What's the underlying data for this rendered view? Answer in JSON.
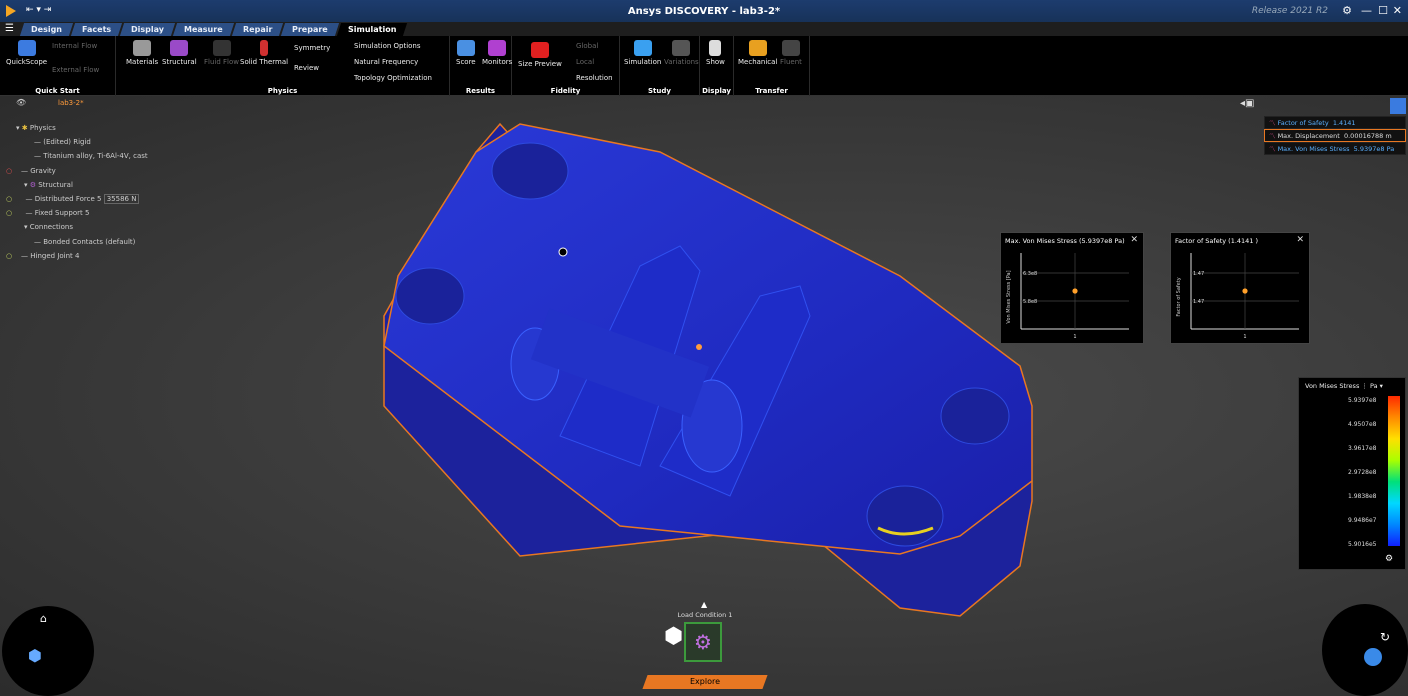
{
  "titlebar": {
    "title": "Ansys DISCOVERY - lab3-2*",
    "release": "Release 2021 R2"
  },
  "tabs": [
    {
      "label": "Design"
    },
    {
      "label": "Facets"
    },
    {
      "label": "Display"
    },
    {
      "label": "Measure"
    },
    {
      "label": "Repair"
    },
    {
      "label": "Prepare"
    },
    {
      "label": "Simulation"
    }
  ],
  "ribbon": {
    "groups": {
      "quickstart": "Quick Start",
      "physics": "Physics",
      "results": "Results",
      "fidelity": "Fidelity",
      "study": "Study",
      "display": "Display",
      "transfer": "Transfer"
    },
    "quickstart": {
      "quickscope": "QuickScope",
      "internal_flow": "Internal Flow",
      "external_flow": "External Flow"
    },
    "physics": {
      "materials": "Materials",
      "structural": "Structural",
      "fluid_flow": "Fluid Flow",
      "solid_thermal": "Solid Thermal",
      "symmetry": "Symmetry",
      "review": "Review",
      "sim_options": "Simulation Options",
      "natural_freq": "Natural Frequency",
      "topology": "Topology Optimization"
    },
    "results": {
      "score": "Score",
      "monitors": "Monitors"
    },
    "fidelity": {
      "size_preview": "Size Preview",
      "global": "Global",
      "local": "Local",
      "resolution": "Resolution"
    },
    "study": {
      "simulation": "Simulation",
      "variations": "Variations"
    },
    "display": {
      "show": "Show"
    },
    "transfer": {
      "mechanical": "Mechanical",
      "fluent": "Fluent"
    }
  },
  "breadcrumb": {
    "file": "lab3-2*"
  },
  "tree": {
    "physics": "Physics",
    "edited": "(Edited) Rigid",
    "material": "Titanium alloy, Ti-6Al-4V, cast",
    "gravity": "Gravity",
    "structural": "Structural",
    "force": "Distributed Force 5",
    "force_value": "35586 N",
    "support": "Fixed Support 5",
    "connections": "Connections",
    "bonded": "Bonded Contacts (default)",
    "hinged": "Hinged Joint 4"
  },
  "results_panel": [
    {
      "label": "Factor of Safety",
      "value": "1.4141"
    },
    {
      "label": "Max. Displacement",
      "value": "0.00016788 m"
    },
    {
      "label": "Max. Von Mises Stress",
      "value": "5.9397e8 Pa"
    }
  ],
  "charts": [
    {
      "title": "Max. Von Mises Stress",
      "value": "(5.9397e8 Pa)",
      "ylabel": "Von Mises Stress [Pa]",
      "yticks": [
        "6.3e8",
        "5.8e8"
      ],
      "xtick": "1"
    },
    {
      "title": "Factor of Safety",
      "value": "(1.4141 )",
      "ylabel": "Factor of Safety",
      "yticks": [
        "1.47",
        "1.47"
      ],
      "xtick": "1"
    }
  ],
  "chart_data": [
    {
      "type": "scatter",
      "title": "Max. Von Mises Stress (5.9397e8 Pa)",
      "ylabel": "Von Mises Stress [Pa]",
      "x": [
        1
      ],
      "y": [
        593970000
      ]
    },
    {
      "type": "scatter",
      "title": "Factor of Safety (1.4141 )",
      "ylabel": "Factor of Safety",
      "x": [
        1
      ],
      "y": [
        1.4141
      ]
    }
  ],
  "legend": {
    "title": "Von Mises Stress",
    "unit": "Pa",
    "values": [
      "5.9397e8",
      "4.9507e8",
      "3.9617e8",
      "2.9728e8",
      "1.9838e8",
      "9.9486e7",
      "5.9016e5"
    ]
  },
  "hud": {
    "load_condition": "Load Condition 1",
    "explore": "Explore"
  },
  "colors": {
    "accent": "#e87722",
    "tab": "#2c4f86",
    "link": "#5ab0ff"
  }
}
